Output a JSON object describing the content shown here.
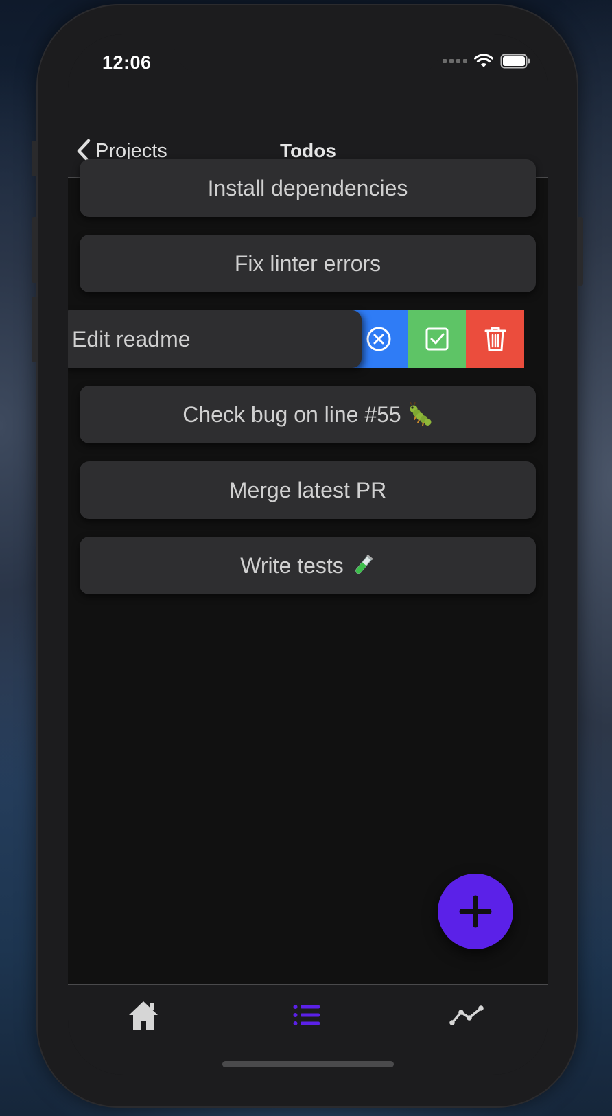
{
  "status_bar": {
    "time": "12:06",
    "icons": [
      "cellular-signal-icon",
      "wifi-icon",
      "battery-icon"
    ]
  },
  "nav": {
    "back_label": "Projects",
    "title": "Todos"
  },
  "todos": [
    {
      "label": "Install dependencies",
      "emoji": ""
    },
    {
      "label": "Fix linter errors",
      "emoji": ""
    },
    {
      "label": "Edit readme",
      "emoji": "",
      "swiped": true
    },
    {
      "label": "Check bug on line #55",
      "emoji": "caterpillar-emoji"
    },
    {
      "label": "Merge latest PR",
      "emoji": ""
    },
    {
      "label": "Write tests",
      "emoji": "test-tube-emoji"
    }
  ],
  "swipe_actions": [
    {
      "name": "cancel",
      "icon": "close-circle-icon",
      "color": "#2f7cf6"
    },
    {
      "name": "complete",
      "icon": "checkbox-icon",
      "color": "#5ec466"
    },
    {
      "name": "delete",
      "icon": "trash-icon",
      "color": "#eb4d3d"
    }
  ],
  "fab": {
    "icon": "plus-icon",
    "color": "#5b21e8"
  },
  "tabs": [
    {
      "name": "home",
      "icon": "home-icon",
      "active": false
    },
    {
      "name": "todos",
      "icon": "list-icon",
      "active": true
    },
    {
      "name": "stats",
      "icon": "chart-line-icon",
      "active": false
    }
  ],
  "colors": {
    "accent": "#5b21e8",
    "card": "#2e2e30",
    "background": "#111111",
    "bar": "#1c1c1e"
  }
}
